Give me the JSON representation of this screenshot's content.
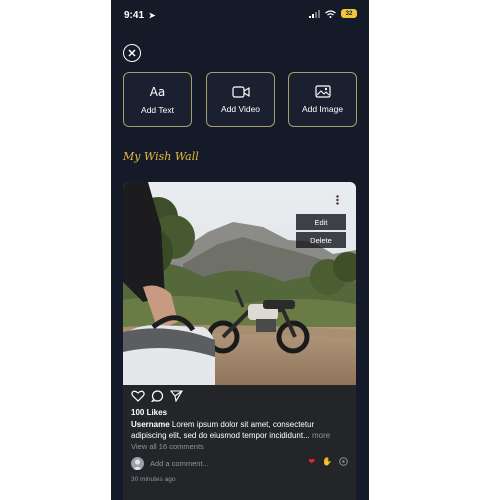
{
  "status_bar": {
    "time": "9:41",
    "battery": "32"
  },
  "actions": [
    {
      "label": "Add Text",
      "icon": "text-icon"
    },
    {
      "label": "Add Video",
      "icon": "video-icon"
    },
    {
      "label": "Add Image",
      "icon": "image-icon"
    }
  ],
  "wall_title": "My Wish Wall",
  "post": {
    "menu": {
      "edit": "Edit",
      "delete": "Delete"
    },
    "likes": "100 Likes",
    "username": "Username",
    "caption": "Lorem ipsum dolor sit amet, consectetur adipiscing elit, sed do eiusmod tempor incididunt...",
    "more": "more",
    "view_comments": "View all 16 comments",
    "comment_placeholder": "Add a comment...",
    "time_ago": "30 minutes ago"
  },
  "colors": {
    "background": "#151a28",
    "accent": "#e8b93a",
    "tile_border": "#a39f6a"
  }
}
